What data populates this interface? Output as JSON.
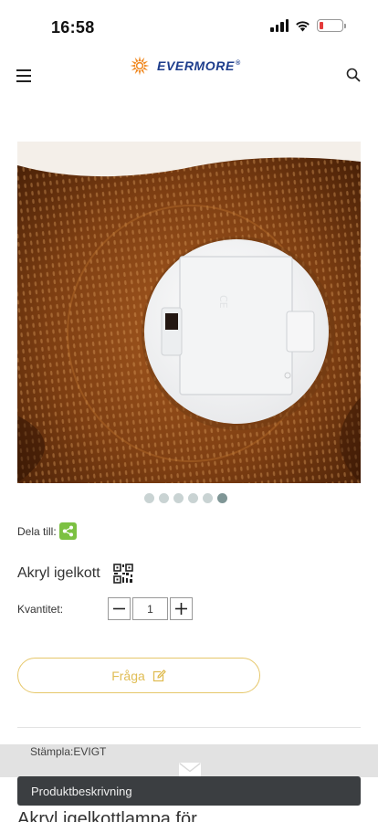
{
  "status_bar": {
    "time": "16:58"
  },
  "header": {
    "logo_text": "EVERMORE",
    "logo_mark": "®"
  },
  "carousel": {
    "slide_count": 6,
    "active_index": 5
  },
  "share": {
    "label": "Dela till:"
  },
  "product": {
    "title": "Akryl igelkott"
  },
  "quantity": {
    "label": "Kvantitet:",
    "value": "1"
  },
  "inquiry": {
    "label": "Fråga"
  },
  "footer": {
    "brand": "Stämpla:EVIGT",
    "description_label": "Produktbeskrivning",
    "next_heading": "Akryl igelkottlampa för"
  },
  "colors": {
    "accent": "#e0bd55",
    "brand_blue": "#1d3d8c",
    "share_green": "#7cc142",
    "bar_dark": "#3b3e41"
  }
}
